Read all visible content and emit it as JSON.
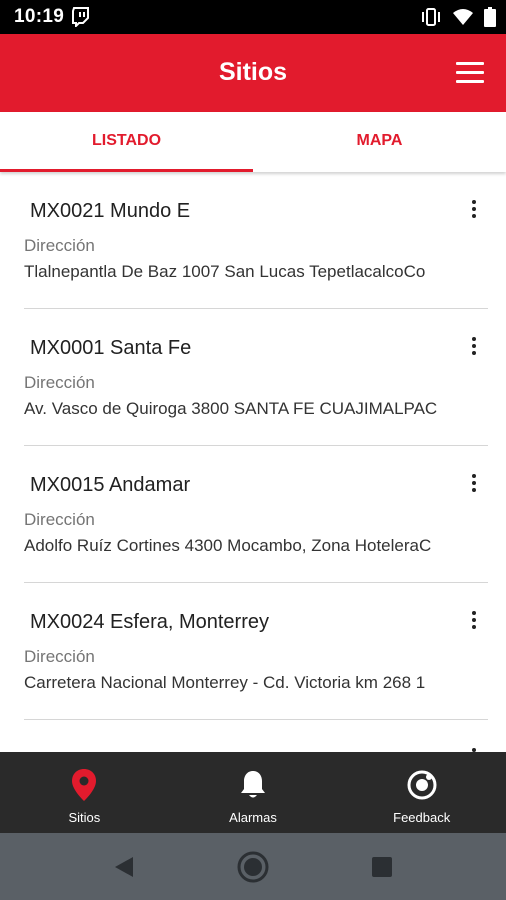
{
  "status_bar": {
    "time": "10:19"
  },
  "app_bar": {
    "title": "Sitios"
  },
  "tabs": [
    {
      "label": "LISTADO",
      "active": true
    },
    {
      "label": "MAPA",
      "active": false
    }
  ],
  "sites": [
    {
      "name": "MX0021 Mundo E",
      "label": "Dirección",
      "address": "Tlalnepantla De Baz 1007 San Lucas TepetlacalcoCo"
    },
    {
      "name": "MX0001 Santa Fe",
      "label": "Dirección",
      "address": "Av. Vasco de Quiroga 3800 SANTA FE CUAJIMALPAC"
    },
    {
      "name": "MX0015 Andamar",
      "label": "Dirección",
      "address": "Adolfo Ruíz Cortines 4300 Mocambo, Zona HoteleraC"
    },
    {
      "name": "MX0024 Esfera, Monterrey",
      "label": "Dirección",
      "address": "Carretera Nacional Monterrey - Cd. Victoria km 268 1"
    }
  ],
  "bottom_nav": [
    {
      "label": "Sitios",
      "icon": "map-pin-icon",
      "color": "#e21b2d"
    },
    {
      "label": "Alarmas",
      "icon": "bell-icon",
      "color": "#ffffff"
    },
    {
      "label": "Feedback",
      "icon": "feedback-icon",
      "color": "#ffffff"
    }
  ],
  "colors": {
    "accent": "#e21b2d",
    "nav_bg": "#2a2a2a",
    "system_nav_bg": "#5a6066"
  }
}
